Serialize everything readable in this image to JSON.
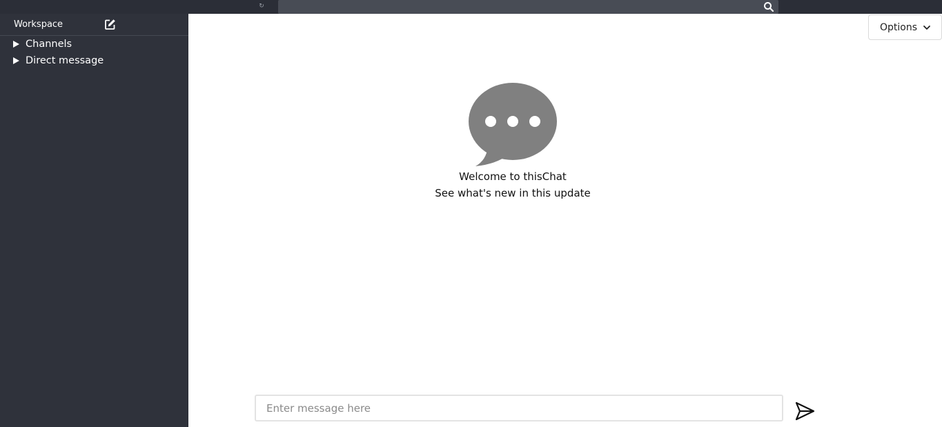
{
  "topbar": {
    "refresh_glyph": "↻",
    "search": {
      "placeholder": "",
      "value": ""
    }
  },
  "sidebar": {
    "workspace_title": "Workspace",
    "sections": [
      {
        "label": "Channels",
        "expanded": false
      },
      {
        "label": "Direct message",
        "expanded": false
      }
    ]
  },
  "main": {
    "options_label": "Options",
    "welcome_title": "Welcome to thisChat",
    "welcome_subtitle": "See what's new in this update",
    "composer": {
      "placeholder": "Enter message here",
      "value": ""
    }
  },
  "colors": {
    "topbar_bg": "#2b2e37",
    "sidebar_bg": "#2f323b",
    "search_bg": "#484c55",
    "bubble_gray": "#808080"
  },
  "icons": {
    "refresh": "refresh-icon",
    "search": "search-icon",
    "edit": "edit-icon",
    "caret": "caret-right-icon",
    "chevron": "chevron-down-icon",
    "chat_bubble": "chat-bubble-icon",
    "send": "send-icon"
  }
}
